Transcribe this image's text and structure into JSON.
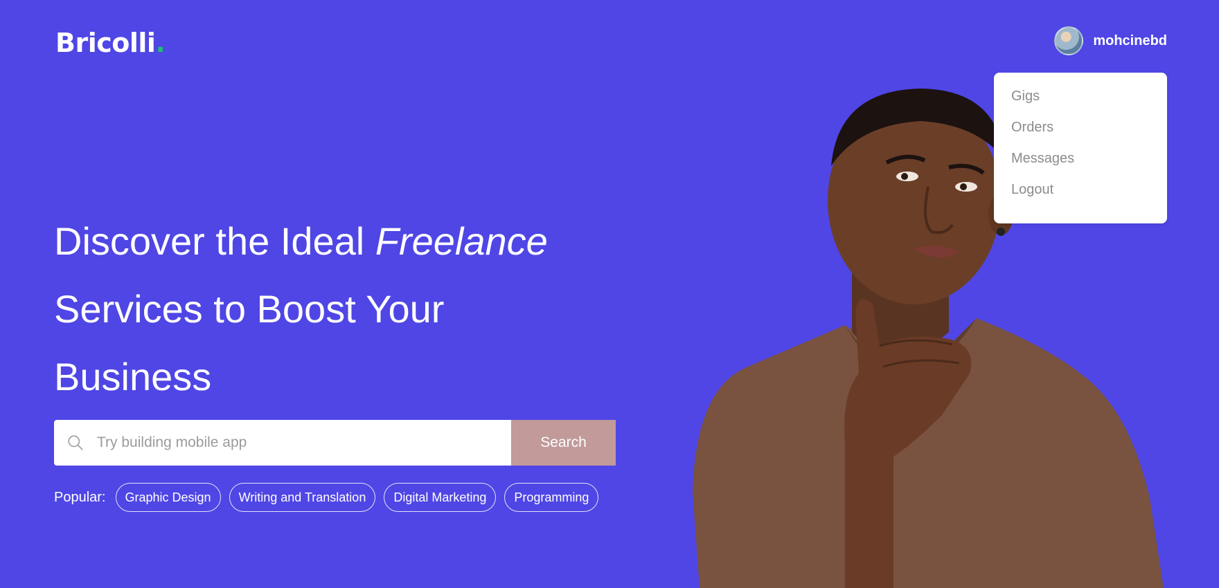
{
  "header": {
    "logo_text": "Bricolli",
    "logo_dot": ".",
    "user": {
      "name": "mohcinebd"
    }
  },
  "menu": {
    "items": [
      {
        "label": "Gigs"
      },
      {
        "label": "Orders"
      },
      {
        "label": "Messages"
      },
      {
        "label": "Logout"
      }
    ]
  },
  "hero": {
    "line1": "Discover the Ideal",
    "line1_italic": "Freelance",
    "line2": "Services to Boost Your",
    "line3": "Business"
  },
  "search": {
    "placeholder": "Try building mobile app",
    "value": "",
    "button_label": "Search"
  },
  "popular": {
    "label": "Popular:",
    "tags": [
      {
        "label": "Graphic Design"
      },
      {
        "label": "Writing and Translation"
      },
      {
        "label": "Digital Marketing"
      },
      {
        "label": "Programming"
      }
    ]
  },
  "colors": {
    "background": "#4f46e5",
    "accent_dot": "#1dbf73",
    "search_button": "#c19a99",
    "menu_text": "#8b8b8b"
  },
  "icons": {
    "search": "search-icon"
  }
}
